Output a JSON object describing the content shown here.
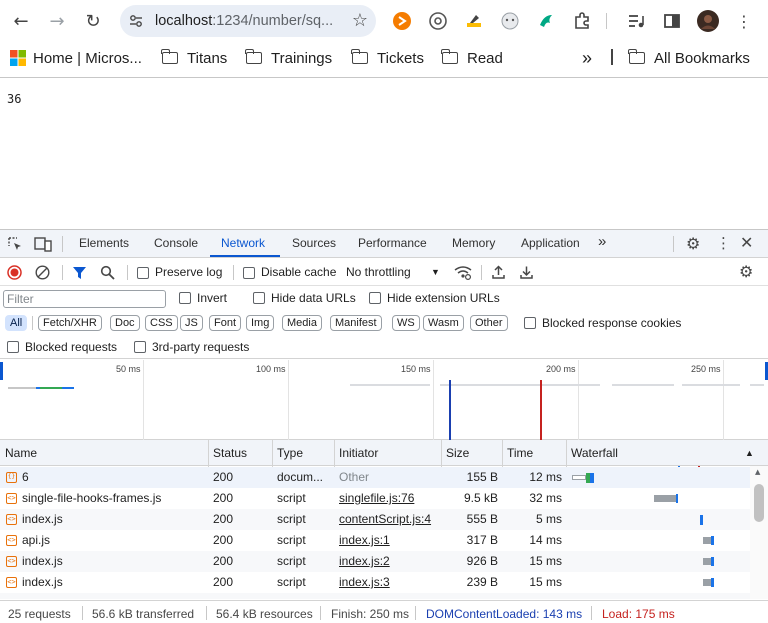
{
  "browser": {
    "url_host": "localhost",
    "url_path": ":1234/number/sq...",
    "bookmarks": [
      {
        "label": "Home | Micros..."
      },
      {
        "label": "Titans"
      },
      {
        "label": "Trainings"
      },
      {
        "label": "Tickets"
      },
      {
        "label": "Read"
      }
    ],
    "overflow_label": "»",
    "all_bookmarks": "All Bookmarks"
  },
  "page": {
    "content": "36"
  },
  "devtools": {
    "tabs": [
      "Elements",
      "Console",
      "Network",
      "Sources",
      "Performance",
      "Memory",
      "Application"
    ],
    "active_tab": "Network",
    "more_tabs": "»",
    "toolbar": {
      "preserve_log": "Preserve log",
      "disable_cache": "Disable cache",
      "throttling": "No throttling"
    },
    "filter": {
      "placeholder": "Filter",
      "invert": "Invert",
      "hide_data_urls": "Hide data URLs",
      "hide_extension_urls": "Hide extension URLs"
    },
    "type_filters": [
      "All",
      "Fetch/XHR",
      "Doc",
      "CSS",
      "JS",
      "Font",
      "Img",
      "Media",
      "Manifest",
      "WS",
      "Wasm",
      "Other"
    ],
    "blocked_response_cookies": "Blocked response cookies",
    "blocked_requests": "Blocked requests",
    "third_party": "3rd-party requests",
    "overview_ticks": [
      "50 ms",
      "100 ms",
      "150 ms",
      "200 ms",
      "250 ms"
    ],
    "columns": [
      "Name",
      "Status",
      "Type",
      "Initiator",
      "Size",
      "Time",
      "Waterfall"
    ],
    "rows": [
      {
        "name": "6",
        "status": "200",
        "type": "docum...",
        "initiator": "Other",
        "size": "155 B",
        "time": "12 ms",
        "icon": "document-icon"
      },
      {
        "name": "single-file-hooks-frames.js",
        "status": "200",
        "type": "script",
        "initiator": "singlefile.js:76",
        "size": "9.5 kB",
        "time": "32 ms",
        "icon": "script-icon"
      },
      {
        "name": "index.js",
        "status": "200",
        "type": "script",
        "initiator": "contentScript.js:4",
        "size": "555 B",
        "time": "5 ms",
        "icon": "script-icon"
      },
      {
        "name": "api.js",
        "status": "200",
        "type": "script",
        "initiator": "index.js:1",
        "size": "317 B",
        "time": "14 ms",
        "icon": "script-icon"
      },
      {
        "name": "index.js",
        "status": "200",
        "type": "script",
        "initiator": "index.js:2",
        "size": "926 B",
        "time": "15 ms",
        "icon": "script-icon"
      },
      {
        "name": "index.js",
        "status": "200",
        "type": "script",
        "initiator": "index.js:3",
        "size": "239 B",
        "time": "15 ms",
        "icon": "script-icon"
      }
    ],
    "status": {
      "requests": "25 requests",
      "transferred": "56.6 kB transferred",
      "resources": "56.4 kB resources",
      "finish": "Finish: 250 ms",
      "domcontentloaded": "DOMContentLoaded: 143 ms",
      "load": "Load: 175 ms"
    },
    "colors": {
      "accent": "#0b57d0",
      "dcl_line": "#1a73e8",
      "load_line": "#c5221f",
      "record": "#d93025"
    }
  }
}
